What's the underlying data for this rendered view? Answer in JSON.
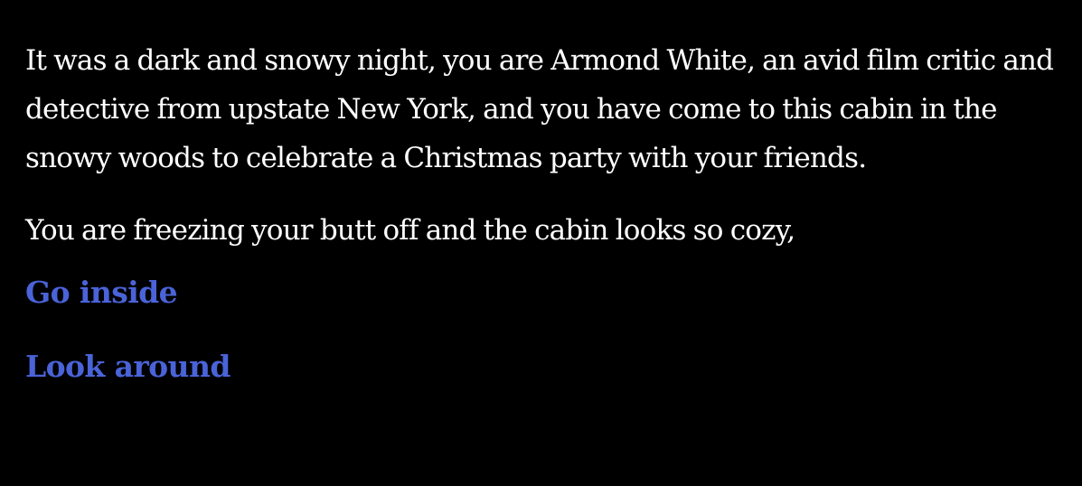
{
  "story": {
    "paragraphs": [
      "It was a dark and snowy night, you are Armond White, an avid film critic and detective from upstate New York, and you have come to this cabin in the snowy woods to celebrate a Christmas party with your friends.",
      "You are freezing your butt off and the cabin looks so cozy,"
    ]
  },
  "choices": [
    {
      "label": "Go inside"
    },
    {
      "label": "Look around"
    }
  ],
  "colors": {
    "background": "#000000",
    "text": "#ffffff",
    "link": "#4a63d8"
  }
}
